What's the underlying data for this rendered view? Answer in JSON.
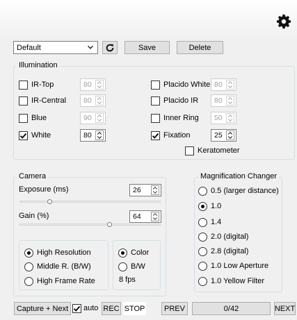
{
  "toolbar": {
    "gear_icon": "gear-icon",
    "preset_value": "Default",
    "refresh_icon": "refresh-icon",
    "save_label": "Save",
    "delete_label": "Delete"
  },
  "illumination": {
    "title": "Illumination",
    "left": [
      {
        "label": "IR-Top",
        "checked": false,
        "value": "80",
        "enabled": false
      },
      {
        "label": "IR-Central",
        "checked": false,
        "value": "80",
        "enabled": false
      },
      {
        "label": "Blue",
        "checked": false,
        "value": "90",
        "enabled": false
      },
      {
        "label": "White",
        "checked": true,
        "value": "80",
        "enabled": true
      }
    ],
    "right": [
      {
        "label": "Placido White",
        "checked": false,
        "value": "80",
        "enabled": false
      },
      {
        "label": "Placido IR",
        "checked": false,
        "value": "80",
        "enabled": false
      },
      {
        "label": "Inner Ring",
        "checked": false,
        "value": "50",
        "enabled": false
      },
      {
        "label": "Fixation",
        "checked": true,
        "value": "25",
        "enabled": true
      }
    ],
    "keratometer_label": "Keratometer",
    "keratometer_checked": false
  },
  "camera": {
    "title": "Camera",
    "exposure_label": "Exposure (ms)",
    "exposure_value": "26",
    "gain_label": "Gain (%)",
    "gain_value": "64",
    "resolution_options": [
      "High Resolution",
      "Middle R. (B/W)",
      "High Frame Rate"
    ],
    "resolution_selected": 0,
    "color_options": [
      "Color",
      "B/W"
    ],
    "color_selected": 0,
    "fps_text": "8 fps"
  },
  "magnification": {
    "title": "Magnification Changer",
    "options": [
      "0.5 (larger distance)",
      "1.0",
      "1.4",
      "2.0 (digital)",
      "2.8 (digital)",
      "1.0 Low Aperture",
      "1.0 Yellow Filter"
    ],
    "selected": 1
  },
  "bottom": {
    "capture_label": "Capture + Next",
    "auto_label": "auto",
    "auto_checked": true,
    "rec_label": "REC",
    "stop_label": "STOP",
    "prev_label": "PREV",
    "counter": "0/42",
    "next_label": "NEXT"
  }
}
